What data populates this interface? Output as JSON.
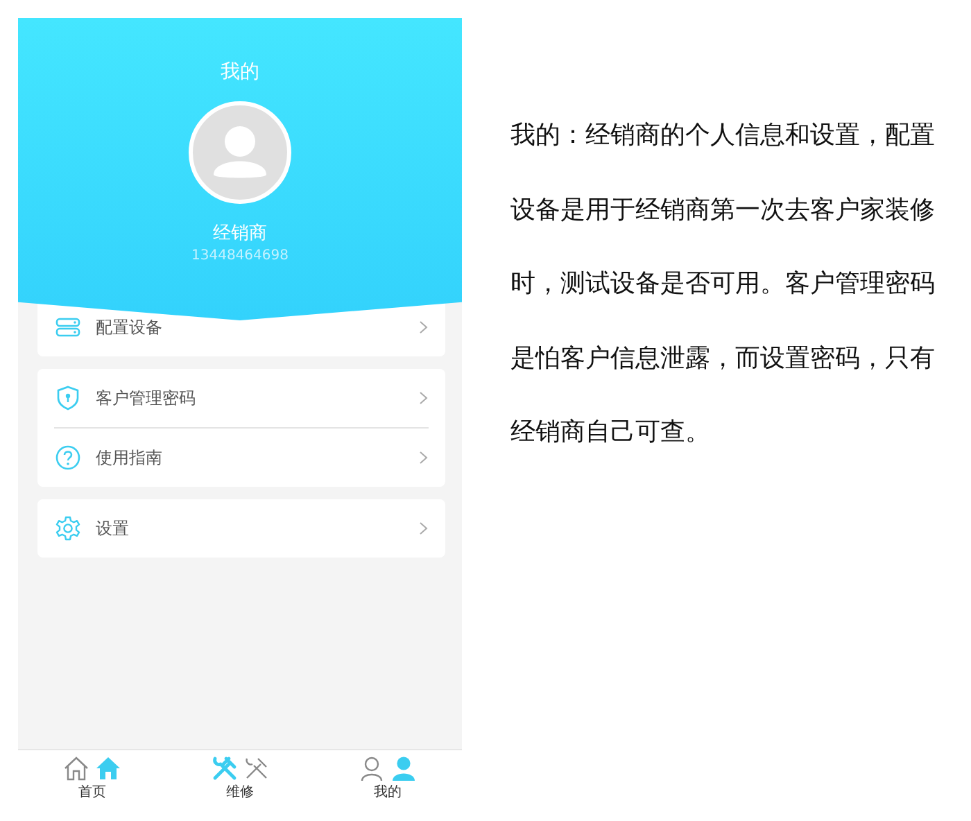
{
  "header": {
    "title": "我的",
    "name": "经销商",
    "phone": "13448464698"
  },
  "groups": [
    [
      {
        "label": "配置设备",
        "kind": "device"
      }
    ],
    [
      {
        "label": "客户管理密码",
        "kind": "shield"
      },
      {
        "label": "使用指南",
        "kind": "help"
      }
    ],
    [
      {
        "label": "设置",
        "kind": "gear"
      }
    ]
  ],
  "tabbar": [
    {
      "label": "首页",
      "kind": "home"
    },
    {
      "label": "维修",
      "kind": "tools"
    },
    {
      "label": "我的",
      "kind": "person"
    }
  ],
  "note": "我的：经销商的个人信息和设置，配置设备是用于经销商第一次去客户家装修时，测试设备是否可用。客户管理密码是怕客户信息泄露，而设置密码，只有经销商自己可查。"
}
